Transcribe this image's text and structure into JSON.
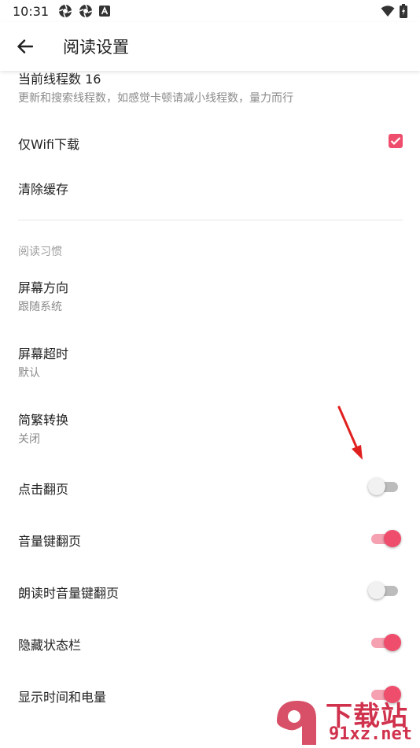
{
  "status_bar": {
    "time": "10:31",
    "icons_left": [
      "aperture-icon",
      "aperture-icon",
      "notification-a-icon"
    ],
    "icons_right": [
      "wifi-icon",
      "battery-icon"
    ]
  },
  "toolbar": {
    "back_icon": "arrow-left-icon",
    "title": "阅读设置"
  },
  "items": {
    "thread_count": {
      "title": "当前线程数 16",
      "summary": "更新和搜索线程数，如感觉卡顿请减小线程数，量力而行"
    },
    "wifi_download": {
      "title": "仅Wifi下载",
      "checked": true
    },
    "clear_cache": {
      "title": "清除缓存"
    },
    "section_reading_habit": "阅读习惯",
    "screen_orientation": {
      "title": "屏幕方向",
      "summary": "跟随系统"
    },
    "screen_timeout": {
      "title": "屏幕超时",
      "summary": "默认"
    },
    "chinese_conversion": {
      "title": "简繁转换",
      "summary": "关闭"
    },
    "tap_page_turn": {
      "title": "点击翻页",
      "enabled": false
    },
    "volume_key_page_turn": {
      "title": "音量键翻页",
      "enabled": true
    },
    "tts_volume_key_page_turn": {
      "title": "朗读时音量键翻页",
      "enabled": false
    },
    "hide_status_bar": {
      "title": "隐藏状态栏",
      "enabled": true
    },
    "show_time_battery": {
      "title": "显示时间和电量",
      "enabled": true
    }
  },
  "colors": {
    "accent": "#ef4d6c",
    "annotation_arrow": "#e0201e"
  },
  "watermark": {
    "top": "下载站",
    "bottom": "91xz.net"
  }
}
